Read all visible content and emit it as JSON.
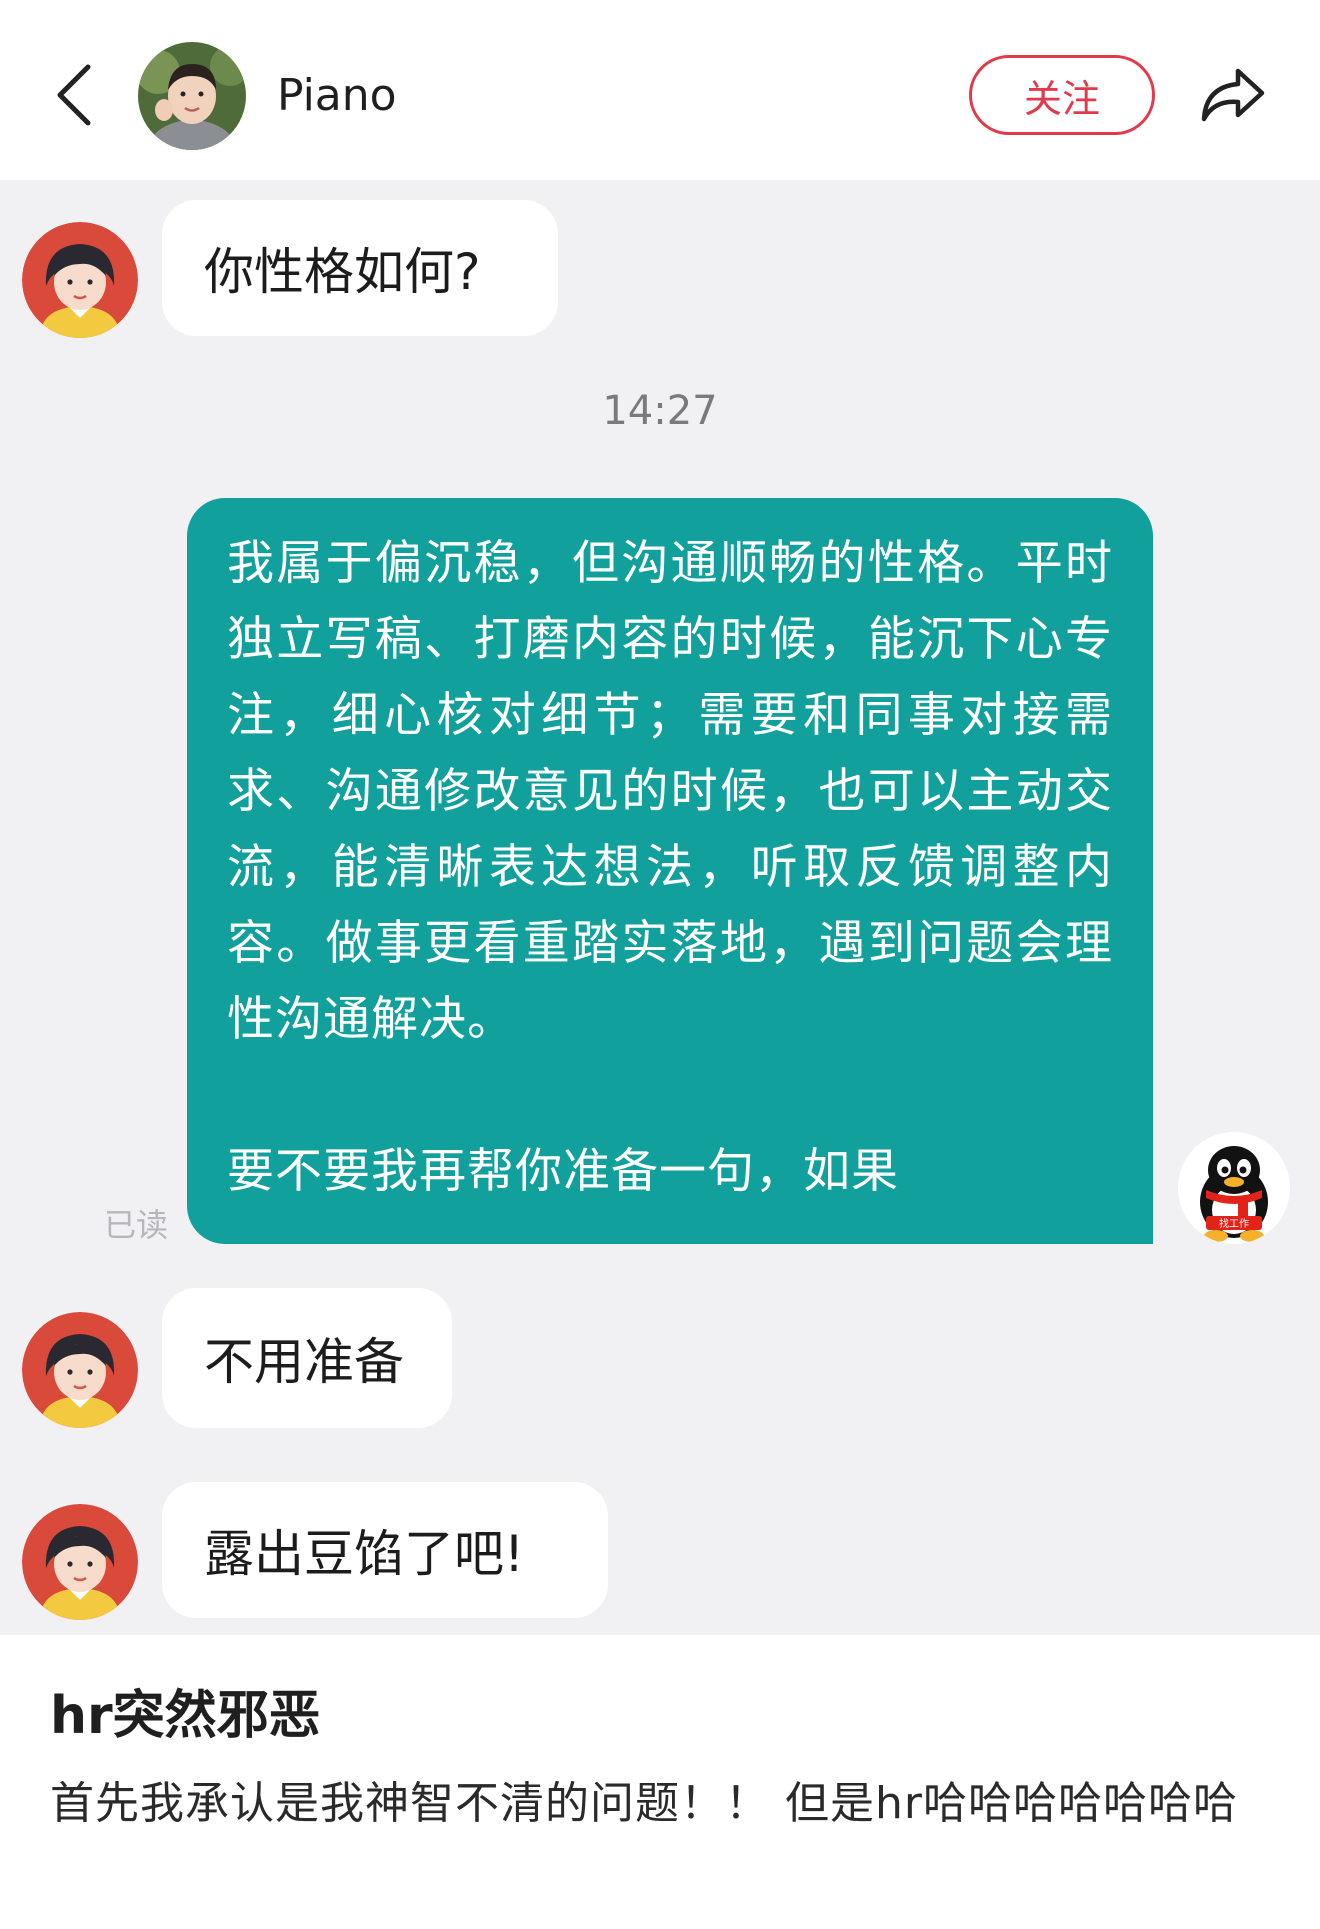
{
  "header": {
    "back_icon": "chevron-left-icon",
    "username": "Piano",
    "follow_label": "关注",
    "share_icon": "share-arrow-icon",
    "accent_color": "#e23a4a"
  },
  "chat": {
    "messages": [
      {
        "sender": "hr",
        "text": "你性格如何?"
      },
      {
        "type": "timestamp",
        "text": "14:27"
      },
      {
        "sender": "me",
        "paragraphs": [
          "我属于偏沉稳，但沟通顺畅的性格。平时独立写稿、打磨内容的时候，能沉下心专注，细心核对细节；需要和同事对接需求、沟通修改意见的时候，也可以主动交流，能清晰表达想法，听取反馈调整内容。做事更看重踏实落地，遇到问题会理性沟通解决。",
          "要不要我再帮你准备一句，如果"
        ],
        "status": "已读",
        "bubble_color": "#12a09c",
        "avatar_badge": "找工作"
      },
      {
        "sender": "hr",
        "text": "不用准备"
      },
      {
        "sender": "hr",
        "text": "露出豆馅了吧!"
      }
    ]
  },
  "post": {
    "title": "hr突然邪恶",
    "body": "首先我承认是我神智不清的问题！！ 但是hr哈哈哈哈哈哈哈"
  }
}
